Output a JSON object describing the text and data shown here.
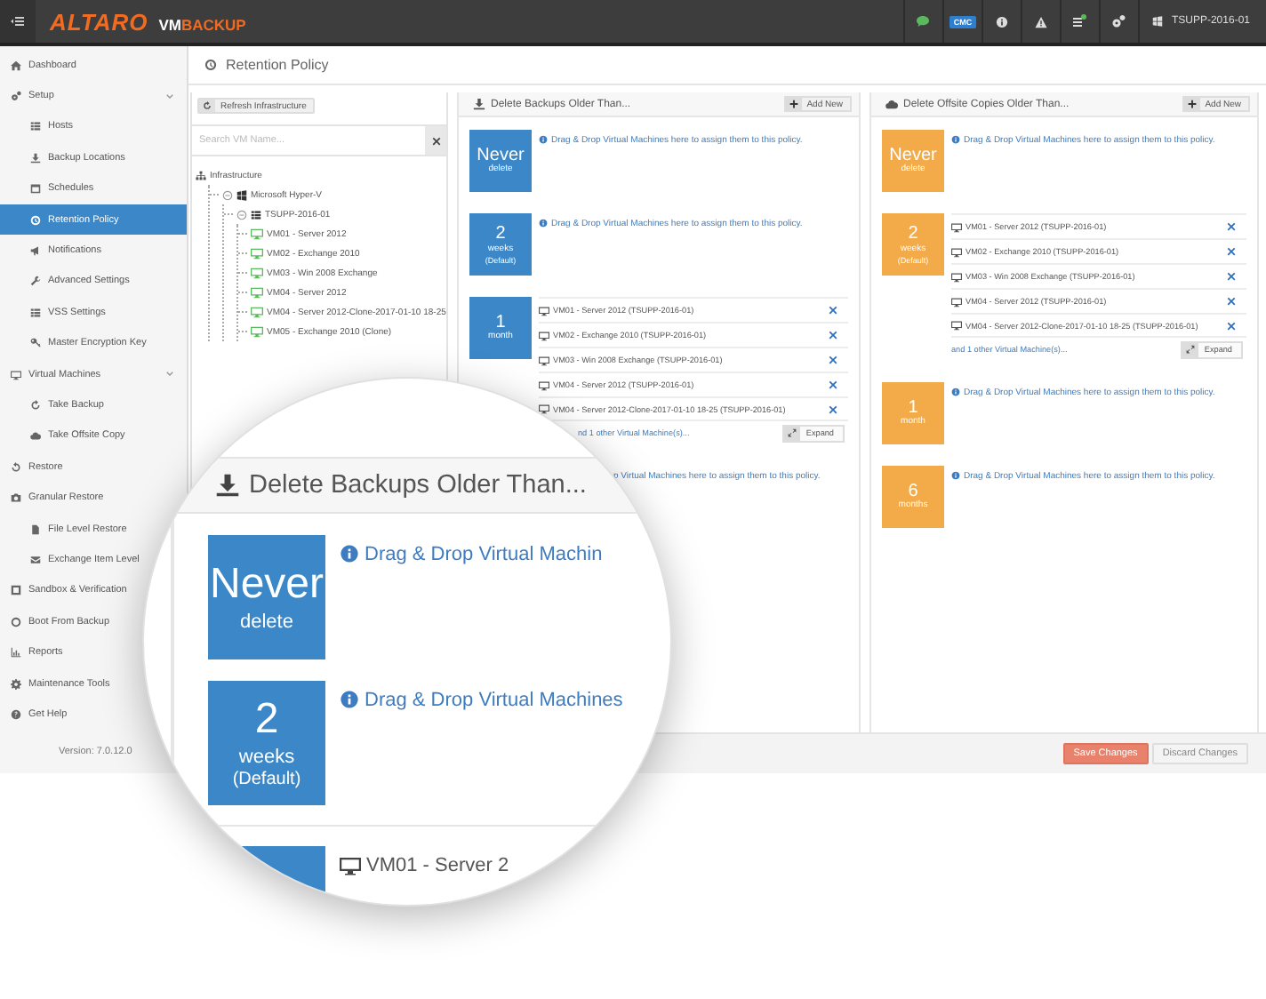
{
  "topbar": {
    "logo": {
      "brand": "ALTARO",
      "prefix": "VM",
      "product": "BACKUP"
    },
    "tools": [
      {
        "kind": "chat"
      },
      {
        "kind": "cmc",
        "label": "CMC"
      },
      {
        "kind": "info"
      },
      {
        "kind": "warning"
      },
      {
        "kind": "tasks"
      },
      {
        "kind": "settings"
      }
    ],
    "host": "TSUPP-2016-01"
  },
  "sidebar": {
    "items": [
      {
        "label": "Dashboard",
        "selected": false
      },
      {
        "label": "Setup",
        "selected": false,
        "expanded": true,
        "children": [
          {
            "label": "Hosts",
            "selected": false
          },
          {
            "label": "Backup Locations",
            "selected": false
          },
          {
            "label": "Schedules",
            "selected": false
          },
          {
            "label": "Retention Policy",
            "selected": true
          },
          {
            "label": "Notifications",
            "selected": false
          },
          {
            "label": "Advanced Settings",
            "selected": false
          },
          {
            "label": "VSS Settings",
            "selected": false
          },
          {
            "label": "Master Encryption Key",
            "selected": false
          }
        ]
      },
      {
        "label": "Virtual Machines",
        "selected": false,
        "expanded": true,
        "children": [
          {
            "label": "Take Backup",
            "selected": false
          },
          {
            "label": "Take Offsite Copy",
            "selected": false
          }
        ]
      },
      {
        "label": "Restore",
        "selected": false
      },
      {
        "label": "Granular Restore",
        "selected": false,
        "children": [
          {
            "label": "File Level Restore",
            "selected": false
          },
          {
            "label": "Exchange Item Level",
            "selected": false
          }
        ]
      },
      {
        "label": "Sandbox & Verification",
        "selected": false
      },
      {
        "label": "Boot From Backup",
        "selected": false
      },
      {
        "label": "Reports",
        "selected": false
      },
      {
        "label": "Maintenance Tools",
        "selected": false
      },
      {
        "label": "Get Help",
        "selected": false
      }
    ],
    "version": "Version: 7.0.12.0"
  },
  "page_title": "Retention Policy",
  "tree_panel": {
    "refresh_button": "Refresh Infrastructure",
    "search": {
      "placeholder": "Search VM Name..."
    },
    "tree": {
      "label": "Infrastructure",
      "kind": "root",
      "children": [
        {
          "label": "Microsoft Hyper-V",
          "kind": "hypervisor",
          "expanded": true,
          "children": [
            {
              "label": "TSUPP-2016-01",
              "kind": "host",
              "expanded": true,
              "children": [
                {
                  "label": "VM01 - Server 2012",
                  "kind": "vm"
                },
                {
                  "label": "VM02 - Exchange 2010",
                  "kind": "vm"
                },
                {
                  "label": "VM03 - Win 2008 Exchange",
                  "kind": "vm"
                },
                {
                  "label": "VM04 - Server 2012",
                  "kind": "vm"
                },
                {
                  "label": "VM04 - Server 2012-Clone-2017-01-10 18-25",
                  "kind": "vm"
                },
                {
                  "label": "VM05 - Exchange 2010 (Clone)",
                  "kind": "vm"
                }
              ]
            }
          ]
        }
      ]
    }
  },
  "columns": [
    {
      "kind": "backup",
      "title": "Delete Backups Older Than...",
      "color": "#3b87c8",
      "add_button": "Add New",
      "policies": [
        {
          "value": "Never",
          "unit": "delete",
          "hint": "Drag & Drop Virtual Machines here to assign them to this policy."
        },
        {
          "value": "2",
          "unit": "weeks",
          "note": "(Default)",
          "hint": "Drag & Drop Virtual Machines here to assign them to this policy."
        },
        {
          "value": "1",
          "unit": "month",
          "vms": [
            "VM01 - Server 2012 (TSUPP-2016-01)",
            "VM02 - Exchange 2010 (TSUPP-2016-01)",
            "VM03 - Win 2008 Exchange (TSUPP-2016-01)",
            "VM04 - Server 2012 (TSUPP-2016-01)",
            "VM04 - Server 2012-Clone-2017-01-10 18-25 (TSUPP-2016-01)"
          ],
          "more": "nd 1 other Virtual Machine(s)...",
          "expand_button": "Expand"
        },
        {
          "hint": "p Virtual Machines here to assign them to this policy."
        }
      ]
    },
    {
      "kind": "offsite",
      "title": "Delete Offsite Copies Older Than...",
      "color": "#f3ab4a",
      "add_button": "Add New",
      "policies": [
        {
          "value": "Never",
          "unit": "delete",
          "hint": "Drag & Drop Virtual Machines here to assign them to this policy."
        },
        {
          "value": "2",
          "unit": "weeks",
          "note": "(Default)",
          "vms": [
            "VM01 - Server 2012 (TSUPP-2016-01)",
            "VM02 - Exchange 2010 (TSUPP-2016-01)",
            "VM03 - Win 2008 Exchange (TSUPP-2016-01)",
            "VM04 - Server 2012 (TSUPP-2016-01)",
            "VM04 - Server 2012-Clone-2017-01-10 18-25 (TSUPP-2016-01)"
          ],
          "more": "and 1 other Virtual Machine(s)...",
          "expand_button": "Expand"
        },
        {
          "value": "1",
          "unit": "month",
          "hint": "Drag & Drop Virtual Machines here to assign them to this policy."
        },
        {
          "value": "6",
          "unit": "months",
          "hint": "Drag & Drop Virtual Machines here to assign them to this policy."
        }
      ]
    }
  ],
  "footer": {
    "buttons": [
      {
        "label": "Save Changes",
        "kind": "primary"
      },
      {
        "label": "Discard Changes",
        "kind": "secondary"
      }
    ]
  },
  "magnifier": {
    "title": "Delete Backups Older Than...",
    "policies": [
      {
        "value": "Never",
        "unit": "delete",
        "hint": "Drag & Drop Virtual Machin"
      },
      {
        "value": "2",
        "unit": "weeks",
        "note": "(Default)",
        "hint": "Drag & Drop Virtual Machines"
      },
      {
        "vm": "VM01 - Server 2"
      }
    ]
  }
}
